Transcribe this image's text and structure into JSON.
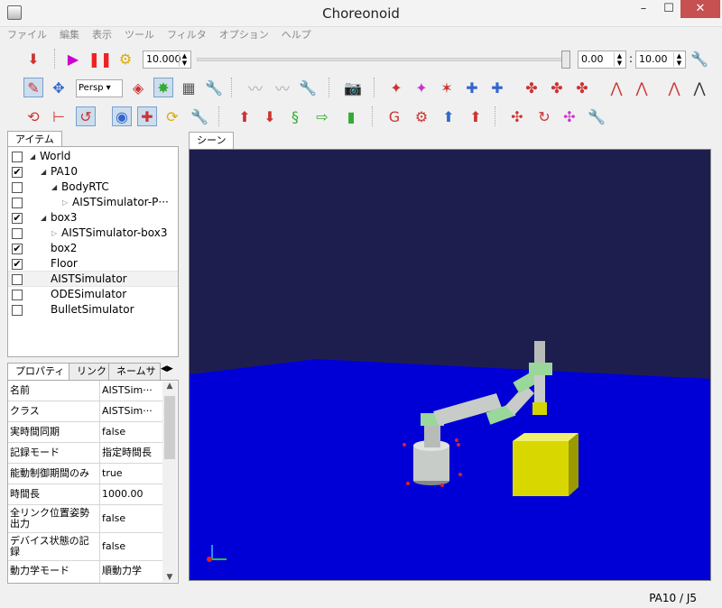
{
  "window": {
    "title": "Choreonoid",
    "minimize": "–",
    "maximize": "☐",
    "close": "✕"
  },
  "menu": [
    "ファイル",
    "編集",
    "表示",
    "ツール",
    "フィルタ",
    "オプション",
    "ヘルプ"
  ],
  "time_toolbar": {
    "time_step": "10.000",
    "current_time": "0.00",
    "time_max": "10.00",
    "separator": ":"
  },
  "scene_toolbar": {
    "camera_mode": "Persp"
  },
  "items_panel": {
    "tab": "アイテム",
    "items": [
      {
        "label": "World",
        "checked": false,
        "expanded": true
      },
      {
        "label": "PA10",
        "checked": true,
        "expanded": true
      },
      {
        "label": "BodyRTC",
        "checked": false,
        "expanded": true
      },
      {
        "label": "AISTSimulator-P···",
        "checked": false,
        "expanded": false
      },
      {
        "label": "box3",
        "checked": true,
        "expanded": true
      },
      {
        "label": "AISTSimulator-box3",
        "checked": false,
        "expanded": false
      },
      {
        "label": "box2",
        "checked": true
      },
      {
        "label": "Floor",
        "checked": true
      },
      {
        "label": "AISTSimulator",
        "checked": false,
        "selected": true
      },
      {
        "label": "ODESimulator",
        "checked": false
      },
      {
        "label": "BulletSimulator",
        "checked": false
      }
    ]
  },
  "properties_panel": {
    "tabs": [
      "プロパティ",
      "リンク",
      "ネームサ"
    ],
    "rows": [
      {
        "key": "名前",
        "value": "AISTSim···"
      },
      {
        "key": "クラス",
        "value": "AISTSim···"
      },
      {
        "key": "実時間同期",
        "value": "false"
      },
      {
        "key": "記録モード",
        "value": "指定時間長"
      },
      {
        "key": "能動制御期間のみ",
        "value": "true"
      },
      {
        "key": "時間長",
        "value": "1000.00"
      },
      {
        "key": "全リンク位置姿勢出力",
        "value": "false"
      },
      {
        "key": "デバイス状態の記録",
        "value": "false"
      },
      {
        "key": "動力学モード",
        "value": "順動力学"
      }
    ]
  },
  "scene_view": {
    "tab": "シーン"
  },
  "colors": {
    "sky": "#1e1e4e",
    "floor": "#0000d6",
    "box": "#d8d800",
    "robot": "#c8ccc8",
    "joint": "#9ad79a"
  },
  "status": "PA10 / J5"
}
